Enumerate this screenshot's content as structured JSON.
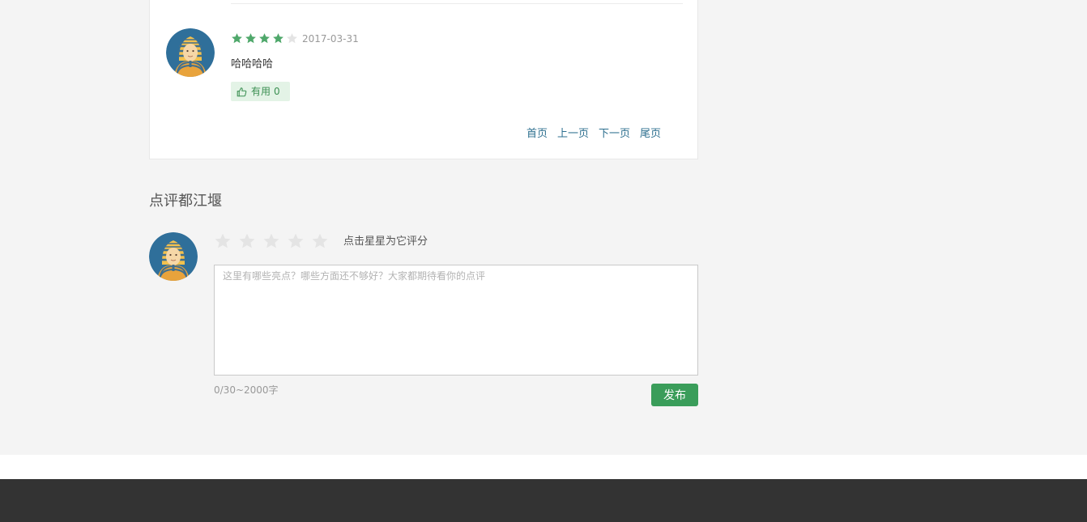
{
  "review": {
    "rating": 4,
    "max_rating": 5,
    "date": "2017-03-31",
    "text": "哈哈哈哈",
    "useful_label": "有用",
    "useful_count": "0"
  },
  "pager": {
    "first": "首页",
    "prev": "上一页",
    "next": "下一页",
    "last": "尾页"
  },
  "write_review": {
    "title": "点评都江堰",
    "rating_hint": "点击星星为它评分",
    "placeholder": "这里有哪些亮点？哪些方面还不够好？大家都期待看你的点评",
    "char_count": "0/30~2000字",
    "publish_label": "发布"
  },
  "colors": {
    "star_filled": "#4fa86b",
    "star_empty": "#e4e4e4",
    "accent_green": "#3a9d5a",
    "link_blue": "#2d6f8f",
    "footer_bg": "#333333"
  },
  "icons": {
    "avatar": "pharaoh-avatar-icon",
    "useful": "thumbs-up-icon",
    "star": "star-icon"
  }
}
